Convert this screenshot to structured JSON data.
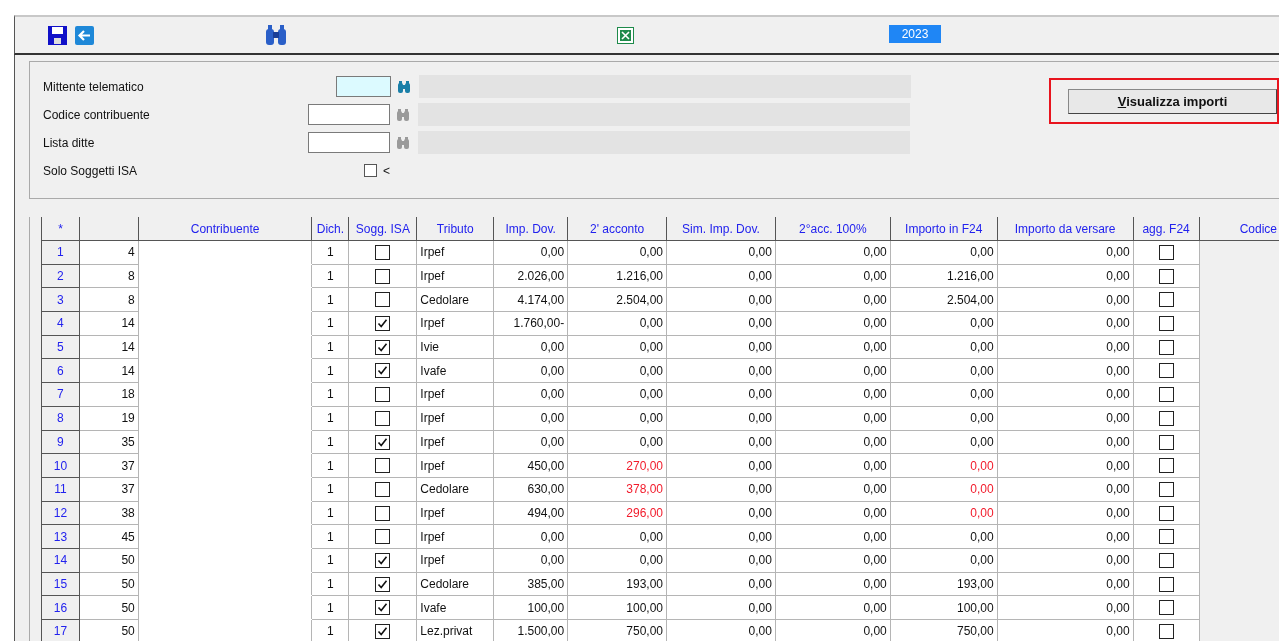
{
  "toolbar": {
    "year": "2023"
  },
  "form": {
    "fields": [
      {
        "label": "Mittente telematico",
        "focused": true
      },
      {
        "label": "Codice contribuente",
        "focused": false
      },
      {
        "label": "Lista ditte",
        "focused": false
      }
    ],
    "isa_filter": {
      "label": "Solo Soggetti ISA",
      "checked": false,
      "marker": "<"
    },
    "button": "Visualizza importi"
  },
  "table": {
    "columns": [
      "*",
      "",
      "Contribuente",
      "Dich.",
      "Sogg. ISA",
      "Tributo",
      "Imp. Dov.",
      "2' acconto",
      "Sim. Imp. Dov.",
      "2°acc. 100%",
      "Importo in F24",
      "Importo da versare",
      "agg. F24",
      "Codice"
    ],
    "rows": [
      {
        "n": "1",
        "code": "4",
        "dich": "1",
        "isa": false,
        "tributo": "Irpef",
        "imp_dov": "0,00",
        "acconto": "0,00",
        "sim": "0,00",
        "acc100": "0,00",
        "f24": "0,00",
        "versare": "0,00",
        "agg": false,
        "alert": false
      },
      {
        "n": "2",
        "code": "8",
        "dich": "1",
        "isa": false,
        "tributo": "Irpef",
        "imp_dov": "2.026,00",
        "acconto": "1.216,00",
        "sim": "0,00",
        "acc100": "0,00",
        "f24": "1.216,00",
        "versare": "0,00",
        "agg": false,
        "alert": false
      },
      {
        "n": "3",
        "code": "8",
        "dich": "1",
        "isa": false,
        "tributo": "Cedolare",
        "imp_dov": "4.174,00",
        "acconto": "2.504,00",
        "sim": "0,00",
        "acc100": "0,00",
        "f24": "2.504,00",
        "versare": "0,00",
        "agg": false,
        "alert": false
      },
      {
        "n": "4",
        "code": "14",
        "dich": "1",
        "isa": true,
        "tributo": "Irpef",
        "imp_dov": "1.760,00-",
        "acconto": "0,00",
        "sim": "0,00",
        "acc100": "0,00",
        "f24": "0,00",
        "versare": "0,00",
        "agg": false,
        "alert": false
      },
      {
        "n": "5",
        "code": "14",
        "dich": "1",
        "isa": true,
        "tributo": "Ivie",
        "imp_dov": "0,00",
        "acconto": "0,00",
        "sim": "0,00",
        "acc100": "0,00",
        "f24": "0,00",
        "versare": "0,00",
        "agg": false,
        "alert": false
      },
      {
        "n": "6",
        "code": "14",
        "dich": "1",
        "isa": true,
        "tributo": "Ivafe",
        "imp_dov": "0,00",
        "acconto": "0,00",
        "sim": "0,00",
        "acc100": "0,00",
        "f24": "0,00",
        "versare": "0,00",
        "agg": false,
        "alert": false
      },
      {
        "n": "7",
        "code": "18",
        "dich": "1",
        "isa": false,
        "tributo": "Irpef",
        "imp_dov": "0,00",
        "acconto": "0,00",
        "sim": "0,00",
        "acc100": "0,00",
        "f24": "0,00",
        "versare": "0,00",
        "agg": false,
        "alert": false
      },
      {
        "n": "8",
        "code": "19",
        "dich": "1",
        "isa": false,
        "tributo": "Irpef",
        "imp_dov": "0,00",
        "acconto": "0,00",
        "sim": "0,00",
        "acc100": "0,00",
        "f24": "0,00",
        "versare": "0,00",
        "agg": false,
        "alert": false
      },
      {
        "n": "9",
        "code": "35",
        "dich": "1",
        "isa": true,
        "tributo": "Irpef",
        "imp_dov": "0,00",
        "acconto": "0,00",
        "sim": "0,00",
        "acc100": "0,00",
        "f24": "0,00",
        "versare": "0,00",
        "agg": false,
        "alert": false
      },
      {
        "n": "10",
        "code": "37",
        "dich": "1",
        "isa": false,
        "tributo": "Irpef",
        "imp_dov": "450,00",
        "acconto": "270,00",
        "sim": "0,00",
        "acc100": "0,00",
        "f24": "0,00",
        "versare": "0,00",
        "agg": false,
        "alert": true
      },
      {
        "n": "11",
        "code": "37",
        "dich": "1",
        "isa": false,
        "tributo": "Cedolare",
        "imp_dov": "630,00",
        "acconto": "378,00",
        "sim": "0,00",
        "acc100": "0,00",
        "f24": "0,00",
        "versare": "0,00",
        "agg": false,
        "alert": true
      },
      {
        "n": "12",
        "code": "38",
        "dich": "1",
        "isa": false,
        "tributo": "Irpef",
        "imp_dov": "494,00",
        "acconto": "296,00",
        "sim": "0,00",
        "acc100": "0,00",
        "f24": "0,00",
        "versare": "0,00",
        "agg": false,
        "alert": true
      },
      {
        "n": "13",
        "code": "45",
        "dich": "1",
        "isa": false,
        "tributo": "Irpef",
        "imp_dov": "0,00",
        "acconto": "0,00",
        "sim": "0,00",
        "acc100": "0,00",
        "f24": "0,00",
        "versare": "0,00",
        "agg": false,
        "alert": false
      },
      {
        "n": "14",
        "code": "50",
        "dich": "1",
        "isa": true,
        "tributo": "Irpef",
        "imp_dov": "0,00",
        "acconto": "0,00",
        "sim": "0,00",
        "acc100": "0,00",
        "f24": "0,00",
        "versare": "0,00",
        "agg": false,
        "alert": false
      },
      {
        "n": "15",
        "code": "50",
        "dich": "1",
        "isa": true,
        "tributo": "Cedolare",
        "imp_dov": "385,00",
        "acconto": "193,00",
        "sim": "0,00",
        "acc100": "0,00",
        "f24": "193,00",
        "versare": "0,00",
        "agg": false,
        "alert": false
      },
      {
        "n": "16",
        "code": "50",
        "dich": "1",
        "isa": true,
        "tributo": "Ivafe",
        "imp_dov": "100,00",
        "acconto": "100,00",
        "sim": "0,00",
        "acc100": "0,00",
        "f24": "100,00",
        "versare": "0,00",
        "agg": false,
        "alert": false
      },
      {
        "n": "17",
        "code": "50",
        "dich": "1",
        "isa": true,
        "tributo": "Lez.privat",
        "imp_dov": "1.500,00",
        "acconto": "750,00",
        "sim": "0,00",
        "acc100": "0,00",
        "f24": "750,00",
        "versare": "0,00",
        "agg": false,
        "alert": false
      }
    ]
  }
}
